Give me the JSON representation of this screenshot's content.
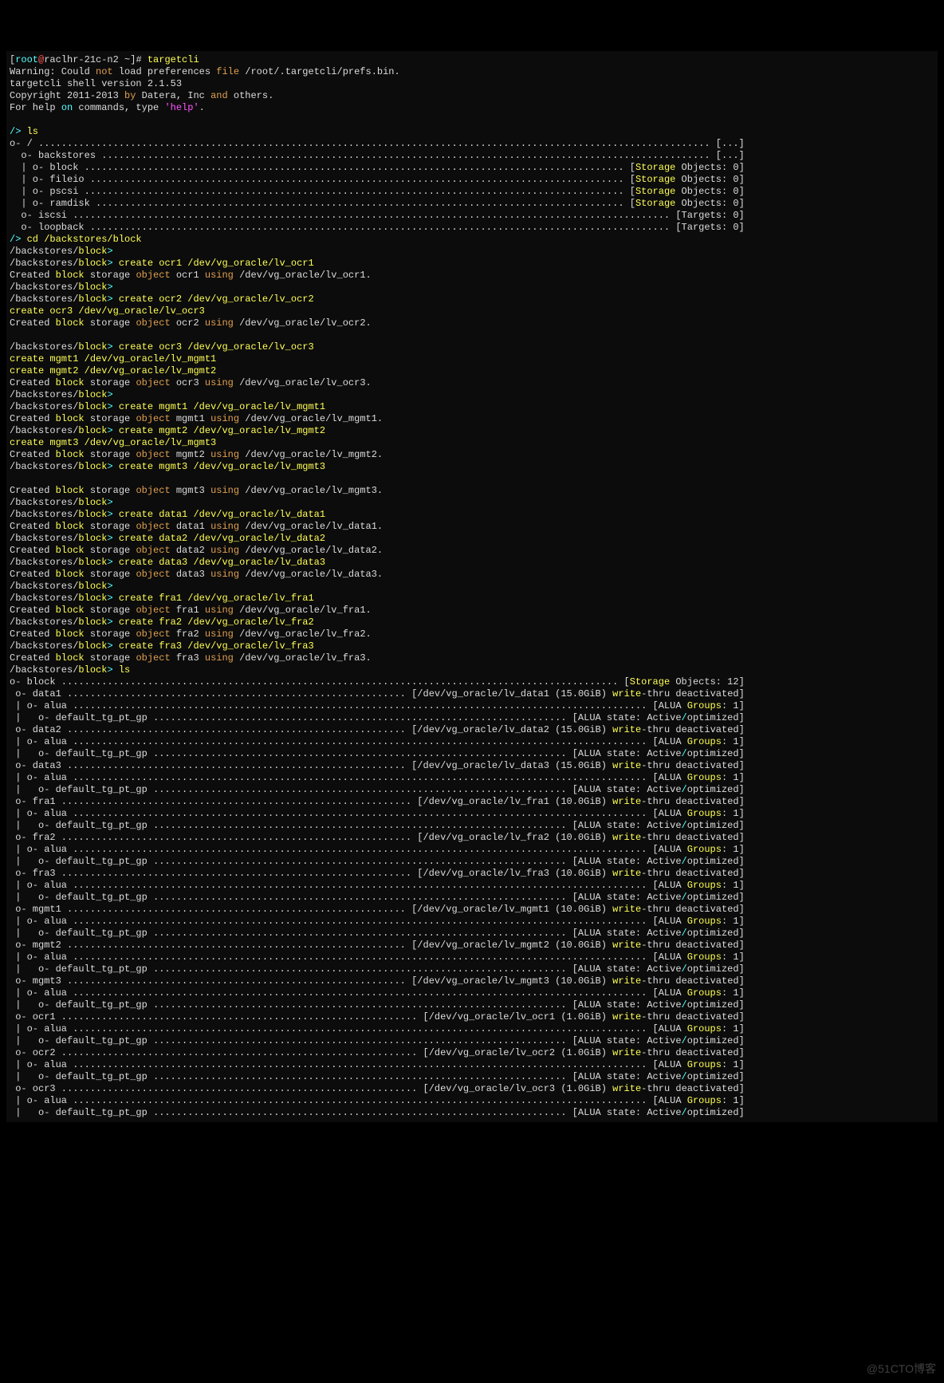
{
  "prompt_user": "root",
  "prompt_host": "raclhr-21c-n2",
  "prompt_dir": "~",
  "shell_cmd": "targetcli",
  "warn_prefix": "Warning: Could ",
  "warn_not": "not",
  "warn_mid": " load preferences ",
  "warn_file": "file",
  "warn_suffix": " /root/.targetcli/prefs.bin.",
  "version_line": "targetcli shell version 2.1.53",
  "copy_prefix": "Copyright 2011-2013 ",
  "copy_by": "by",
  "copy_mid": " Datera, Inc ",
  "copy_and": "and",
  "copy_suffix": " others.",
  "help_prefix": "For help ",
  "help_on": "on",
  "help_mid": " commands, type ",
  "help_str": "'help'",
  "help_dot": ".",
  "root_prompt": "/> ",
  "ls_cmd": "ls",
  "cd_cmd": "cd /backstores/block",
  "ls_tree": {
    "root": "o- / ",
    "root_tag": "[...]",
    "backstores": "o- backstores ",
    "backstores_tag": "[...]",
    "block": "| o- block ",
    "fileio": "| o- fileio ",
    "pscsi": "| o- pscsi ",
    "ramdisk": "| o- ramdisk ",
    "storage_kw": "Storage",
    "storage_obj0": " Objects: 0]",
    "iscsi": "o- iscsi ",
    "loopback": "o- loopback ",
    "targets0": "[Targets: 0]"
  },
  "bb_prompt_path": "/backstores/",
  "bb_prompt_block": "block",
  "bb_prompt_gt": "> ",
  "creates": [
    {
      "cmd": "create ocr1 /dev/vg_oracle/lv_ocr1",
      "name": "ocr1",
      "dev": "/dev/vg_oracle/lv_ocr1"
    },
    {
      "cmd": "create ocr2 /dev/vg_oracle/lv_ocr2",
      "name": "ocr2",
      "dev": "/dev/vg_oracle/lv_ocr2"
    },
    {
      "cmd": "create ocr3 /dev/vg_oracle/lv_ocr3",
      "name": "ocr3",
      "dev": "/dev/vg_oracle/lv_ocr3"
    },
    {
      "cmd": "create mgmt1 /dev/vg_oracle/lv_mgmt1",
      "name": "mgmt1",
      "dev": "/dev/vg_oracle/lv_mgmt1"
    },
    {
      "cmd": "create mgmt2 /dev/vg_oracle/lv_mgmt2",
      "name": "mgmt2",
      "dev": "/dev/vg_oracle/lv_mgmt2"
    },
    {
      "cmd": "create mgmt3 /dev/vg_oracle/lv_mgmt3",
      "name": "mgmt3",
      "dev": "/dev/vg_oracle/lv_mgmt3"
    },
    {
      "cmd": "create data1 /dev/vg_oracle/lv_data1",
      "name": "data1",
      "dev": "/dev/vg_oracle/lv_data1"
    },
    {
      "cmd": "create data2 /dev/vg_oracle/lv_data2",
      "name": "data2",
      "dev": "/dev/vg_oracle/lv_data2"
    },
    {
      "cmd": "create data3 /dev/vg_oracle/lv_data3",
      "name": "data3",
      "dev": "/dev/vg_oracle/lv_data3"
    },
    {
      "cmd": "create fra1 /dev/vg_oracle/lv_fra1",
      "name": "fra1",
      "dev": "/dev/vg_oracle/lv_fra1"
    },
    {
      "cmd": "create fra2 /dev/vg_oracle/lv_fra2",
      "name": "fra2",
      "dev": "/dev/vg_oracle/lv_fra2"
    },
    {
      "cmd": "create fra3 /dev/vg_oracle/lv_fra3",
      "name": "fra3",
      "dev": "/dev/vg_oracle/lv_fra3"
    }
  ],
  "paste_extra": [
    "create ocr3 /dev/vg_oracle/lv_ocr3",
    "create mgmt1 /dev/vg_oracle/lv_mgmt1",
    "create mgmt2 /dev/vg_oracle/lv_mgmt2",
    "create mgmt3 /dev/vg_oracle/lv_mgmt3"
  ],
  "created_word": "Created ",
  "block_word": "block",
  "storage_word": " storage ",
  "object_word": "object",
  "using_word": "using",
  "ls2_header_prefix": "o- block ",
  "ls2_header_storage": "Storage",
  "ls2_header_suffix": " Objects: 12]",
  "ls2_items": [
    {
      "name": "data1",
      "dev": "/dev/vg_oracle/lv_data1",
      "size": "15.0GiB"
    },
    {
      "name": "data2",
      "dev": "/dev/vg_oracle/lv_data2",
      "size": "15.0GiB"
    },
    {
      "name": "data3",
      "dev": "/dev/vg_oracle/lv_data3",
      "size": "15.0GiB"
    },
    {
      "name": "fra1",
      "dev": "/dev/vg_oracle/lv_fra1",
      "size": "10.0GiB"
    },
    {
      "name": "fra2",
      "dev": "/dev/vg_oracle/lv_fra2",
      "size": "10.0GiB"
    },
    {
      "name": "fra3",
      "dev": "/dev/vg_oracle/lv_fra3",
      "size": "10.0GiB"
    },
    {
      "name": "mgmt1",
      "dev": "/dev/vg_oracle/lv_mgmt1",
      "size": "10.0GiB"
    },
    {
      "name": "mgmt2",
      "dev": "/dev/vg_oracle/lv_mgmt2",
      "size": "10.0GiB"
    },
    {
      "name": "mgmt3",
      "dev": "/dev/vg_oracle/lv_mgmt3",
      "size": "10.0GiB"
    },
    {
      "name": "ocr1",
      "dev": "/dev/vg_oracle/lv_ocr1",
      "size": "1.0GiB"
    },
    {
      "name": "ocr2",
      "dev": "/dev/vg_oracle/lv_ocr2",
      "size": "1.0GiB"
    },
    {
      "name": "ocr3",
      "dev": "/dev/vg_oracle/lv_ocr3",
      "size": "1.0GiB"
    }
  ],
  "write_word": "write",
  "thru_deact": "-thru deactivated]",
  "alua_line_prefix": " | o- alua ",
  "alua_kw": "ALUA",
  "groups_kw": "Groups",
  "groups_suffix": ": 1]",
  "def_line_prefix": " |   o- default_tg_pt_gp ",
  "alua_state_prefix": "[ALUA state: Active",
  "optimized": "optimized]",
  "watermark": "@51CTO博客"
}
